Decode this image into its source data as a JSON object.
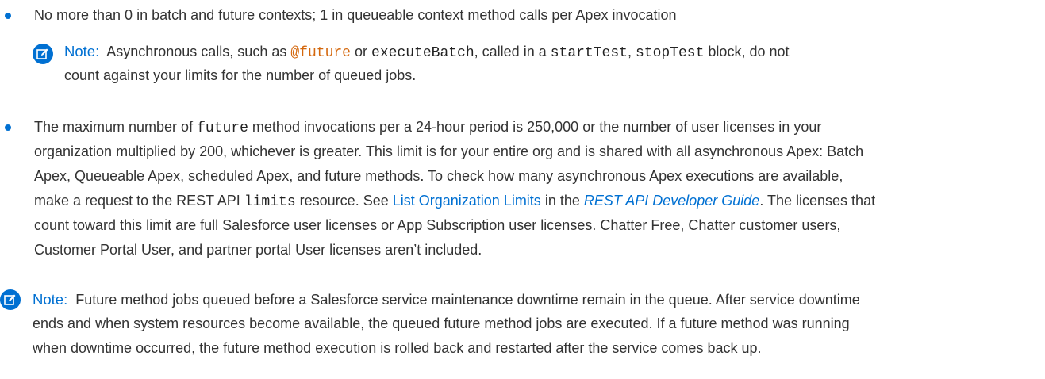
{
  "bullet1": {
    "text": "No more than 0 in batch and future contexts; 1 in queueable context method calls per Apex invocation"
  },
  "note1": {
    "label": "Note:",
    "t1": "Asynchronous calls, such as",
    "code1": "@future",
    "t2": "or",
    "code2": "executeBatch",
    "t3": ", called in a",
    "code3": "startTest",
    "t4": ",",
    "code4": "stopTest",
    "t5": "block, do not",
    "line2": "count against your limits for the number of queued jobs."
  },
  "bullet2": {
    "l1a": "The maximum number of",
    "l1code": "future",
    "l1b": "method invocations per a 24-hour period is 250,000 or the number of user licenses in your",
    "l2": "organization multiplied by 200, whichever is greater. This limit is for your entire org and is shared with all asynchronous Apex: Batch",
    "l3": "Apex, Queueable Apex, scheduled Apex, and future methods. To check how many asynchronous Apex executions are available,",
    "l4a": "make a request to the REST API",
    "l4code": "limits",
    "l4b": "resource. See",
    "l4link1": "List Organization Limits",
    "l4c": "in the",
    "l4link2": "REST API Developer Guide",
    "l4d": ". The licenses that",
    "l5": "count toward this limit are full Salesforce user licenses or App Subscription user licenses. Chatter Free, Chatter customer users,",
    "l6": "Customer Portal User, and partner portal User licenses aren’t included."
  },
  "note2": {
    "label": "Note:",
    "l1": "Future method jobs queued before a Salesforce service maintenance downtime remain in the queue. After service downtime",
    "l2": "ends and when system resources become available, the queued future method jobs are executed. If a future method was running",
    "l3": "when downtime occurred, the future method execution is rolled back and restarted after the service comes back up."
  },
  "colors": {
    "accent": "#0070d2",
    "code_accent": "#d4670c",
    "text": "#333333"
  }
}
